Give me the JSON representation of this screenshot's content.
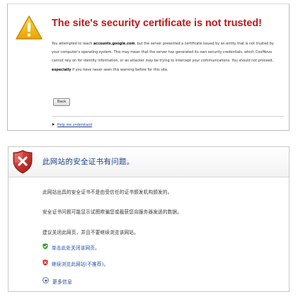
{
  "firefox_warning": {
    "title": "The site's security certificate is not trusted!",
    "body": {
      "t1": "You attempted to reach ",
      "host": "accounts.google.com",
      "t2": ", but the server presented a certificate issued by an entity that is not trusted by your computer's operating system. This may mean that the server has generated its own security credentials, which CoolNovo cannot rely on for identity information, or an attacker may be trying to intercept your communications. You should not proceed, ",
      "emph": "especially",
      "t3": " if you have never seen this warning before for this site."
    },
    "back_label": "Back",
    "help_link": "Help me understand",
    "colors": {
      "title": "#c01818",
      "icon": "#f2b81a"
    }
  },
  "ie_warning": {
    "title": "此网站的安全证书有问题。",
    "line1": "此网站出具的安全证书不是由受信任的证书颁发机构颁发的。",
    "line2": "安全证书问题可能显示试图欺骗您或截获您向服务器发送的数据。",
    "line3": "建议关闭此网页，并且不要继续浏览该网站。",
    "option_close": "单击此处关闭该网页。",
    "option_continue": "继续浏览此网站(不推荐)。",
    "more_info": "更多信息",
    "colors": {
      "title": "#1c3f8c",
      "link": "#1d4fa8",
      "shield": "#c8302a"
    }
  }
}
